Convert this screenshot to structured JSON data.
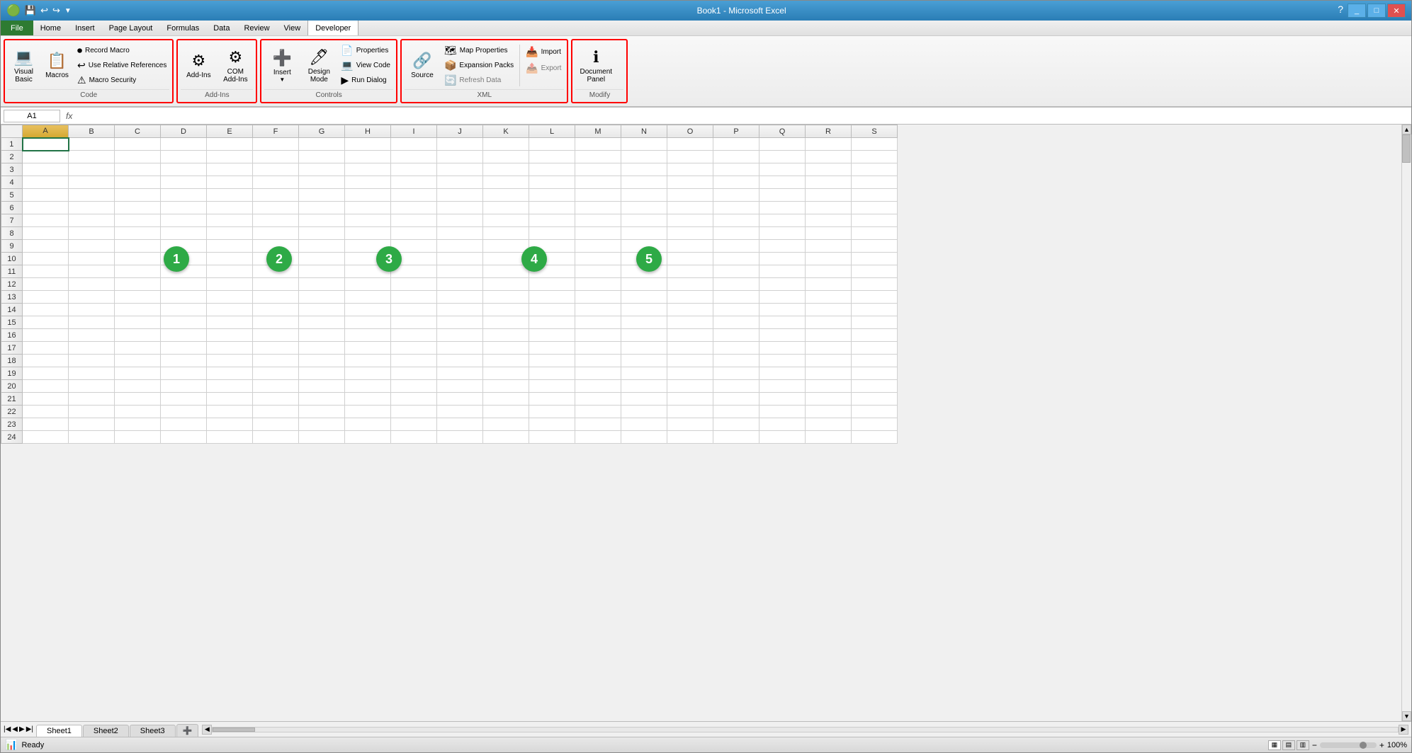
{
  "window": {
    "title": "Book1 - Microsoft Excel"
  },
  "title_bar": {
    "title": "Book1 - Microsoft Excel",
    "controls": [
      "_",
      "□",
      "✕"
    ]
  },
  "menu": {
    "items": [
      "File",
      "Home",
      "Insert",
      "Page Layout",
      "Formulas",
      "Data",
      "Review",
      "View",
      "Developer"
    ]
  },
  "ribbon": {
    "groups": [
      {
        "id": "code",
        "label": "Code",
        "red_border": true,
        "items": [
          {
            "type": "large",
            "icon": "💻",
            "label": "Visual\nBasic"
          },
          {
            "type": "large",
            "icon": "📋",
            "label": "Macros"
          },
          {
            "type": "small-stack",
            "items": [
              {
                "icon": "⏺",
                "label": "Record Macro"
              },
              {
                "icon": "↩",
                "label": "Use Relative References"
              },
              {
                "icon": "⚠",
                "label": "Macro Security"
              }
            ]
          }
        ]
      },
      {
        "id": "addins",
        "label": "Add-Ins",
        "red_border": true,
        "items": [
          {
            "type": "large",
            "icon": "⚙",
            "label": "Add-Ins"
          },
          {
            "type": "large",
            "icon": "⚙",
            "label": "COM\nAdd-Ins"
          }
        ]
      },
      {
        "id": "controls",
        "label": "Controls",
        "red_border": true,
        "items": [
          {
            "type": "large",
            "icon": "➕",
            "label": "Insert"
          },
          {
            "type": "large",
            "icon": "🖊",
            "label": "Design\nMode"
          },
          {
            "type": "small-stack",
            "items": [
              {
                "icon": "📄",
                "label": "Properties"
              },
              {
                "icon": "💻",
                "label": "View Code"
              },
              {
                "icon": "▶",
                "label": "Run Dialog"
              }
            ]
          }
        ]
      },
      {
        "id": "xml",
        "label": "XML",
        "red_border": true,
        "items": [
          {
            "type": "large",
            "icon": "🔗",
            "label": "Source"
          },
          {
            "type": "small-stack",
            "items": [
              {
                "icon": "🗺",
                "label": "Map Properties"
              },
              {
                "icon": "📦",
                "label": "Expansion Packs"
              },
              {
                "icon": "🔄",
                "label": "Refresh Data"
              }
            ]
          },
          {
            "type": "small-stack",
            "items": [
              {
                "icon": "📥",
                "label": "Import"
              },
              {
                "icon": "📤",
                "label": "Export"
              }
            ]
          }
        ]
      },
      {
        "id": "modify",
        "label": "Modify",
        "red_border": true,
        "items": [
          {
            "type": "large",
            "icon": "ℹ",
            "label": "Document\nPanel"
          }
        ]
      }
    ]
  },
  "formula_bar": {
    "cell_ref": "A1",
    "fx_label": "fx"
  },
  "grid": {
    "col_headers": [
      "A",
      "B",
      "C",
      "D",
      "E",
      "F",
      "G",
      "H",
      "I",
      "J",
      "K",
      "L",
      "M",
      "N",
      "O",
      "P",
      "Q",
      "R",
      "S"
    ],
    "row_count": 24,
    "selected_cell": "A1"
  },
  "circles": [
    {
      "number": "1",
      "col": "B"
    },
    {
      "number": "2",
      "col": "D"
    },
    {
      "number": "3",
      "col": "F"
    },
    {
      "number": "4",
      "col": "J"
    },
    {
      "number": "5",
      "col": "L"
    }
  ],
  "sheet_tabs": [
    "Sheet1",
    "Sheet2",
    "Sheet3"
  ],
  "active_sheet": "Sheet1",
  "status_bar": {
    "status": "Ready",
    "zoom": "100%"
  },
  "quick_access": {
    "buttons": [
      "💾",
      "↩",
      "↪"
    ]
  }
}
